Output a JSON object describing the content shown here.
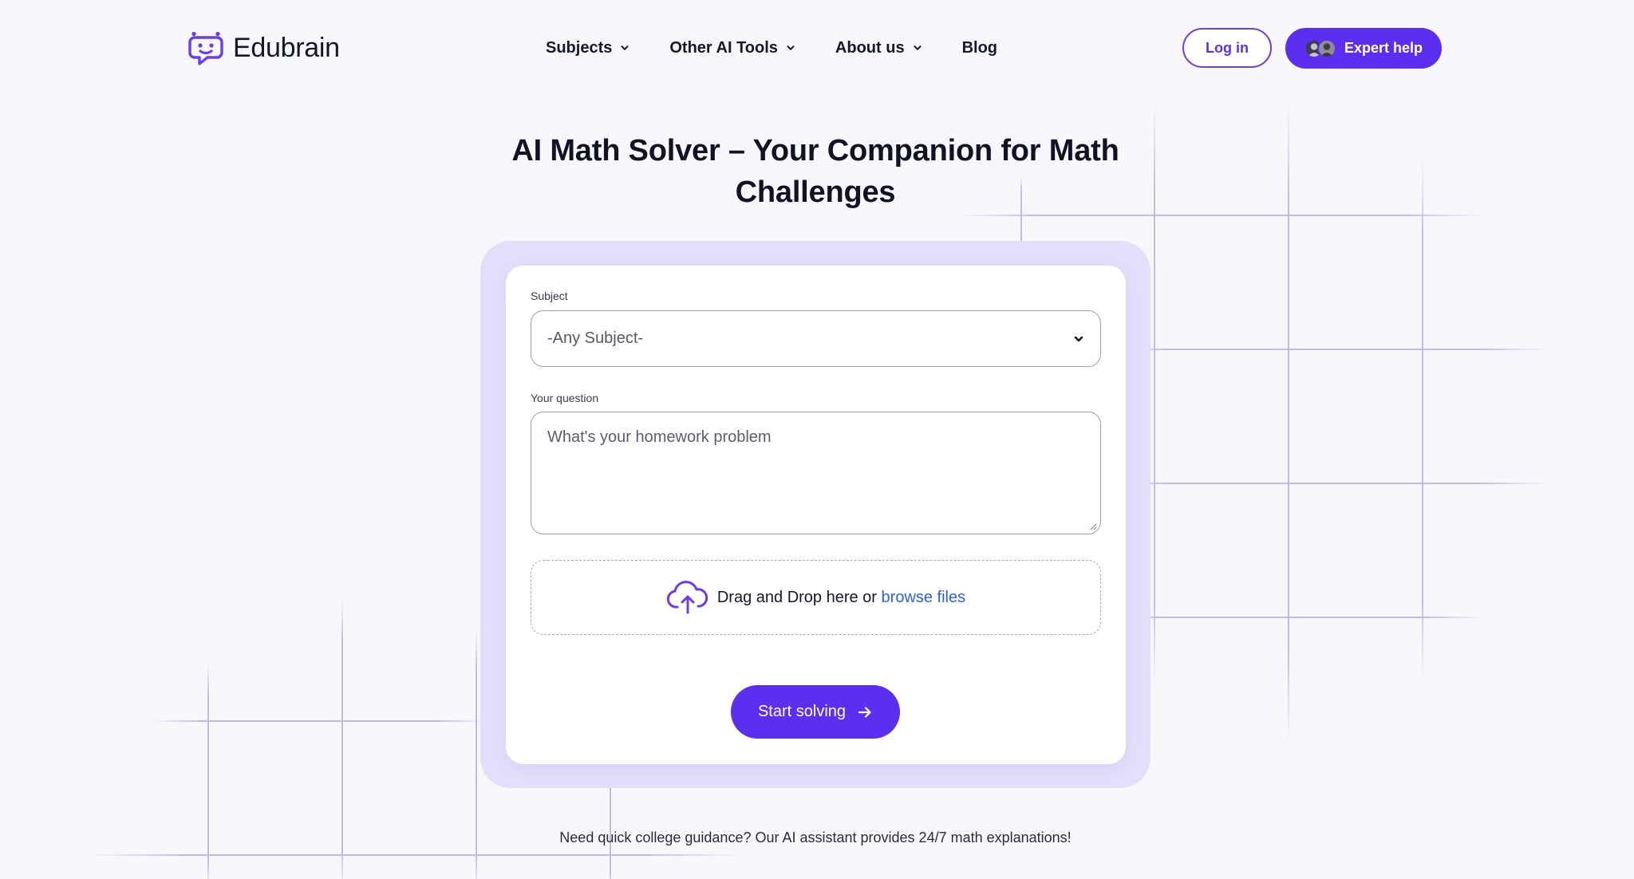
{
  "brand": {
    "name": "Edubrain",
    "accent": "#5c2ff0",
    "logo_color": "#6a3df0"
  },
  "nav": {
    "items": [
      {
        "label": "Subjects",
        "has_dropdown": true
      },
      {
        "label": "Other AI Tools",
        "has_dropdown": true
      },
      {
        "label": "About us",
        "has_dropdown": true
      },
      {
        "label": "Blog",
        "has_dropdown": false
      }
    ]
  },
  "header_actions": {
    "login_label": "Log in",
    "expert_label": "Expert help"
  },
  "hero": {
    "title_line1": "AI Math Solver – Your Companion for Math",
    "title_line2": "Challenges"
  },
  "form": {
    "subject_label": "Subject",
    "subject_value": "-Any Subject-",
    "question_label": "Your question",
    "question_placeholder": "What's your homework problem",
    "dropzone_text": "Drag and Drop here or",
    "browse_label": "browse files",
    "submit_label": "Start solving"
  },
  "footer_note": "Need quick college guidance? Our AI assistant provides 24/7 math explanations!",
  "colors": {
    "page_bg": "#f7f7fc",
    "card_outer": "#e2dffb",
    "link": "#2c5fe6",
    "grid_line": "#b7b4f4"
  },
  "icons": {
    "logo": "chat-bubble-face-icon",
    "nav_dropdown": "chevron-down-icon",
    "upload": "cloud-upload-icon",
    "submit": "arrow-right-icon",
    "expert_avatars": "avatar-group-icon"
  }
}
